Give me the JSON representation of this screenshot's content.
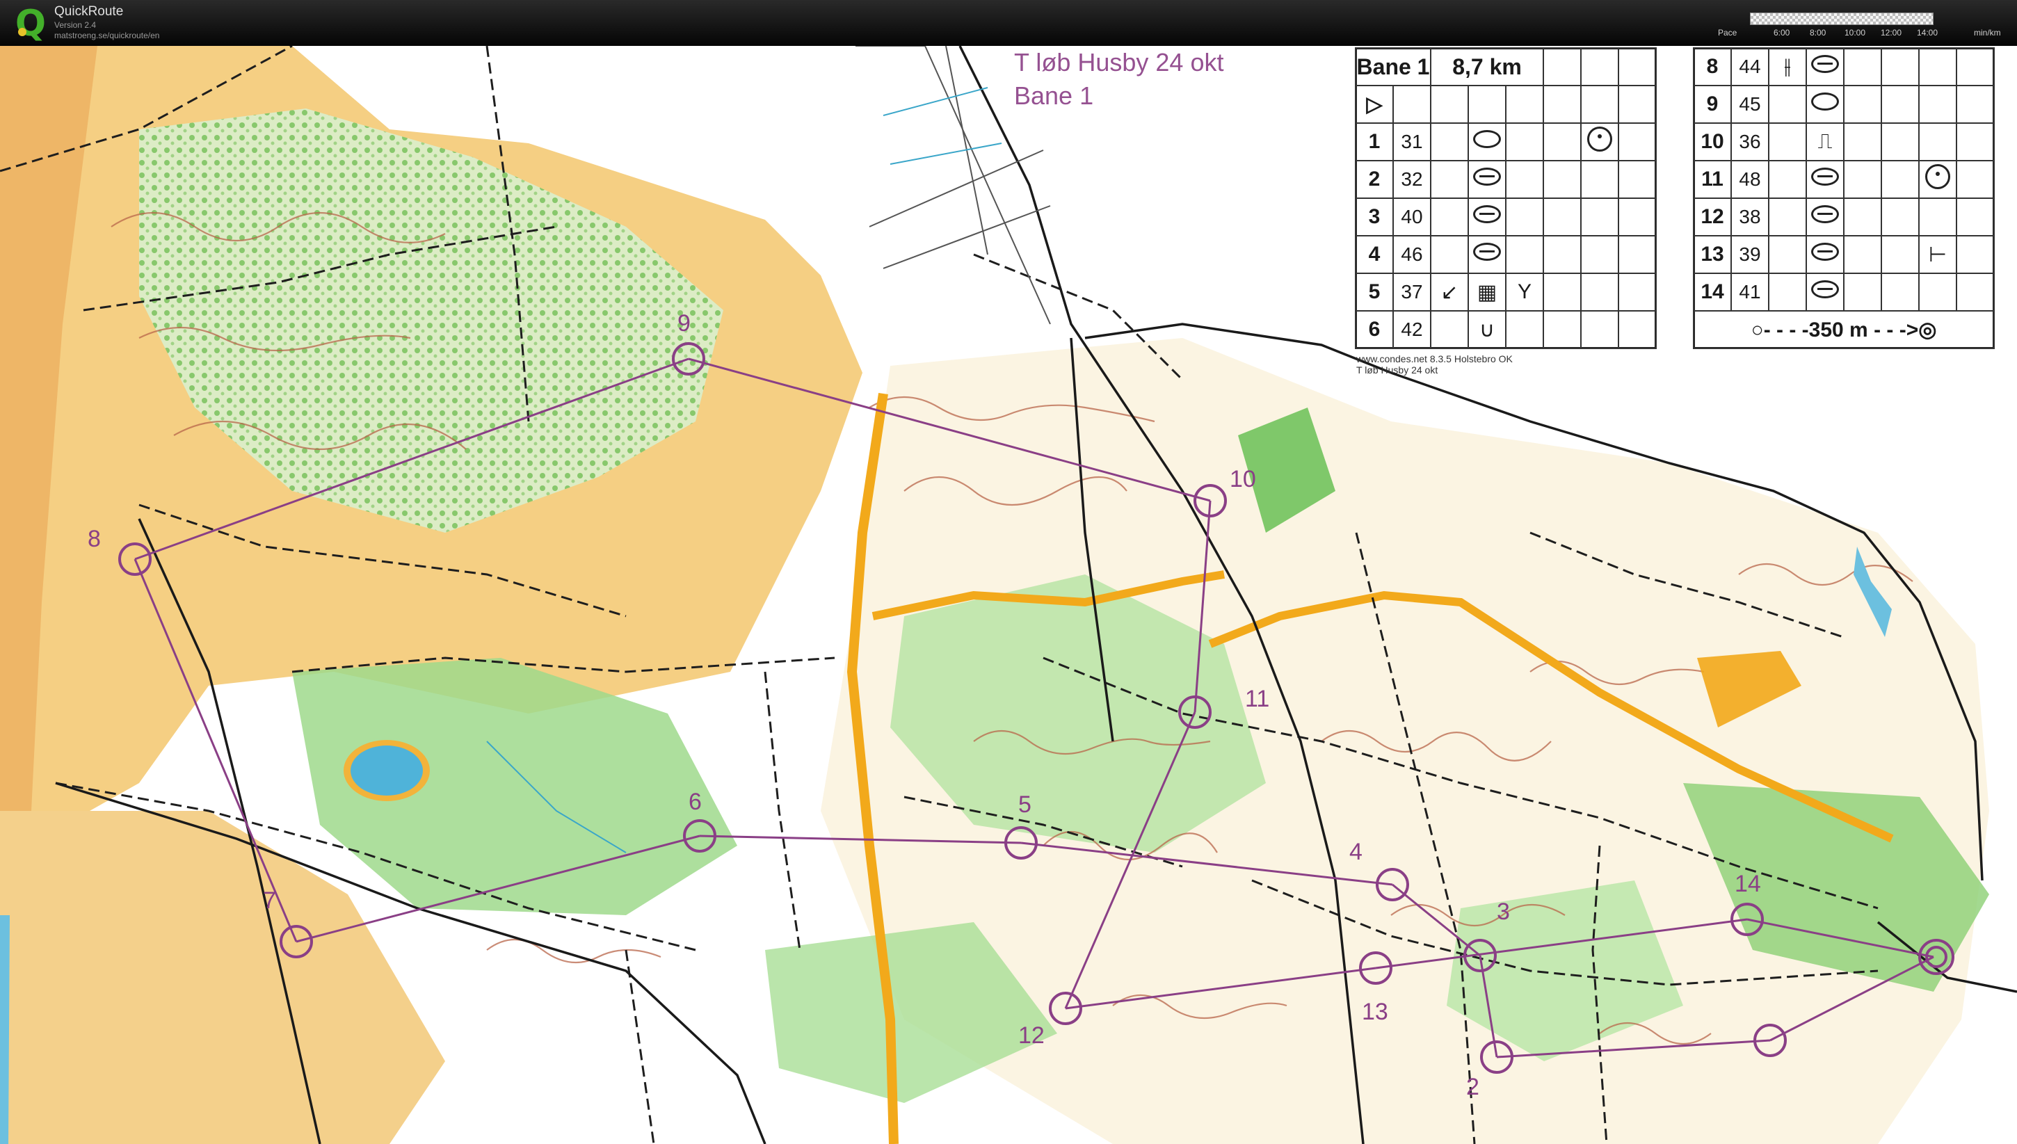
{
  "app": {
    "title": "QuickRoute",
    "version": "Version 2.4",
    "url": "matstroeng.se/quickroute/en"
  },
  "pace_scale": {
    "label": "Pace",
    "ticks": [
      "6:00",
      "8:00",
      "10:00",
      "12:00",
      "14:00"
    ],
    "unit": "min/km"
  },
  "map": {
    "event_title": "T løb Husby 24 okt",
    "course_name": "Bane 1",
    "credits_line1": "www.condes.net 8.3.5 Holstebro OK",
    "credits_line2": "T løb Husby 24 okt",
    "colors": {
      "course": "#8a3f86",
      "open_land": "#f3c978",
      "forest_green": "#8ed27a",
      "road_yellow": "#f2a91b",
      "water": "#4fb3d9",
      "contour": "#b8664a"
    },
    "control_labels": [
      "1",
      "2",
      "3",
      "4",
      "5",
      "6",
      "7",
      "8",
      "9",
      "10",
      "11",
      "12",
      "13",
      "14"
    ]
  },
  "description_sheet": {
    "course": "Bane 1",
    "length": "8,7 km",
    "start_symbol": "▷",
    "left_rows": [
      {
        "n": "1",
        "code": "31",
        "symbol": "oval",
        "extra": "circle"
      },
      {
        "n": "2",
        "code": "32",
        "symbol": "knoll",
        "extra": ""
      },
      {
        "n": "3",
        "code": "40",
        "symbol": "knoll",
        "extra": ""
      },
      {
        "n": "4",
        "code": "46",
        "symbol": "knoll",
        "extra": ""
      },
      {
        "n": "5",
        "code": "37",
        "symbol": "↙",
        "extra": "Y"
      },
      {
        "n": "6",
        "code": "42",
        "symbol": "∪",
        "extra": ""
      }
    ],
    "right_rows": [
      {
        "n": "8",
        "code": "44",
        "symbol": "knoll",
        "extra": ""
      },
      {
        "n": "9",
        "code": "45",
        "symbol": "oval",
        "extra": ""
      },
      {
        "n": "10",
        "code": "36",
        "symbol": "⎍",
        "extra": ""
      },
      {
        "n": "11",
        "code": "48",
        "symbol": "knoll",
        "extra": "circle"
      },
      {
        "n": "12",
        "code": "38",
        "symbol": "knoll",
        "extra": ""
      },
      {
        "n": "13",
        "code": "39",
        "symbol": "knoll",
        "extra": "⊢"
      },
      {
        "n": "14",
        "code": "41",
        "symbol": "knoll",
        "extra": ""
      }
    ],
    "finish_line": "○- - - -350 m - - ->◎"
  }
}
